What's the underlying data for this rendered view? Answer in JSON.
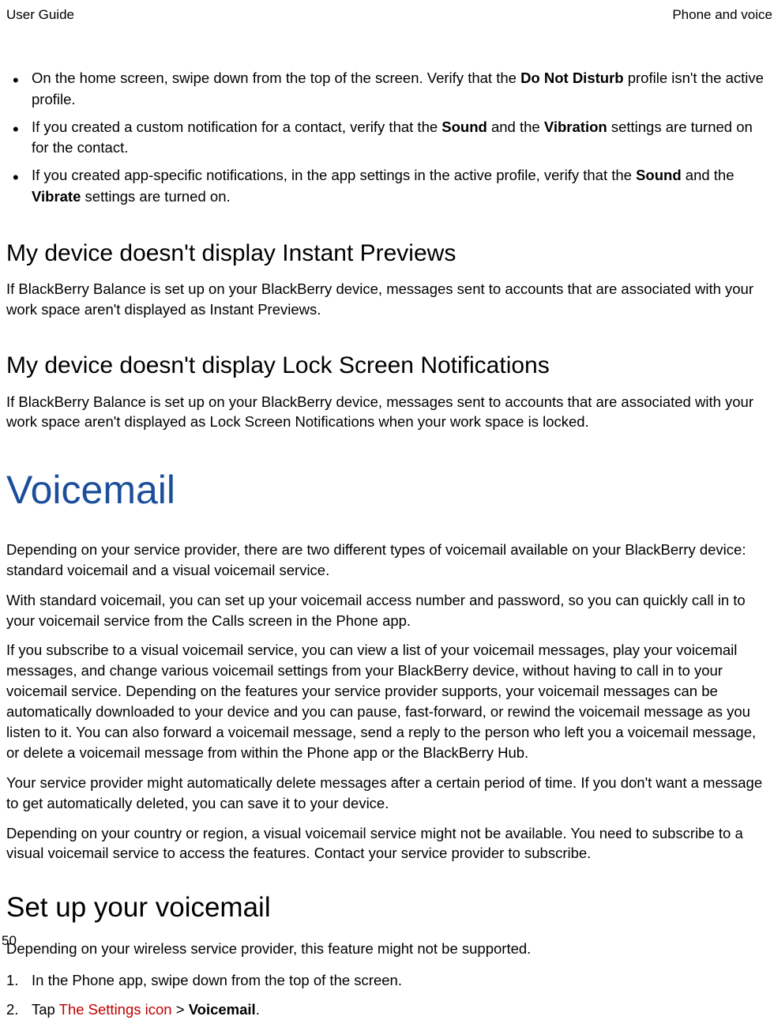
{
  "header": {
    "left": "User Guide",
    "right": "Phone and voice"
  },
  "bullets": [
    {
      "prefix": "On the home screen, swipe down from the top of the screen. Verify that the ",
      "bold1": "Do Not Disturb",
      "suffix": " profile isn't the active profile."
    },
    {
      "prefix": "If you created a custom notification for a contact, verify that the ",
      "bold1": "Sound",
      "mid": " and the ",
      "bold2": "Vibration",
      "suffix": " settings are turned on for the contact."
    },
    {
      "prefix": "If you created app-specific notifications, in the app settings in the active profile, verify that the ",
      "bold1": "Sound",
      "mid": " and the ",
      "bold2": "Vibrate",
      "suffix": " settings are turned on."
    }
  ],
  "section1": {
    "heading": "My device doesn't display Instant Previews",
    "body": "If BlackBerry Balance is set up on your BlackBerry device, messages sent to accounts that are associated with your work space aren't displayed as Instant Previews."
  },
  "section2": {
    "heading": "My device doesn't display Lock Screen Notifications",
    "body": "If BlackBerry Balance is set up on your BlackBerry device, messages sent to accounts that are associated with your work space aren't displayed as Lock Screen Notifications when your work space is locked."
  },
  "voicemail": {
    "title": "Voicemail",
    "p1": "Depending on your service provider, there are two different types of voicemail available on your BlackBerry device: standard voicemail and a visual voicemail service.",
    "p2": "With standard voicemail, you can set up your voicemail access number and password, so you can quickly call in to your voicemail service from the Calls screen in the Phone app.",
    "p3": "If you subscribe to a visual voicemail service, you can view a list of your voicemail messages, play your voicemail messages, and change various voicemail settings from your BlackBerry device, without having to call in to your voicemail service. Depending on the features your service provider supports, your voicemail messages can be automatically downloaded to your device and you can pause, fast-forward, or rewind the voicemail message as you listen to it. You can also forward a voicemail message, send a reply to the person who left you a voicemail message, or delete a voicemail message from within the Phone app or the BlackBerry Hub.",
    "p4": "Your service provider might automatically delete messages after a certain period of time. If you don't want a message to get automatically deleted, you can save it to your device.",
    "p5": "Depending on your country or region, a visual voicemail service might not be available. You need to subscribe to a visual voicemail service to access the features. Contact your service provider to subscribe."
  },
  "setup": {
    "heading": "Set up your voicemail",
    "intro": "Depending on your wireless service provider, this feature might not be supported.",
    "steps": [
      {
        "num": "1.",
        "text": "In the Phone app, swipe down from the top of the screen."
      },
      {
        "num": "2.",
        "prefix": "Tap ",
        "red": " The Settings icon ",
        "mid": " > ",
        "bold": "Voicemail",
        "suffix": "."
      }
    ]
  },
  "pageNumber": "50"
}
